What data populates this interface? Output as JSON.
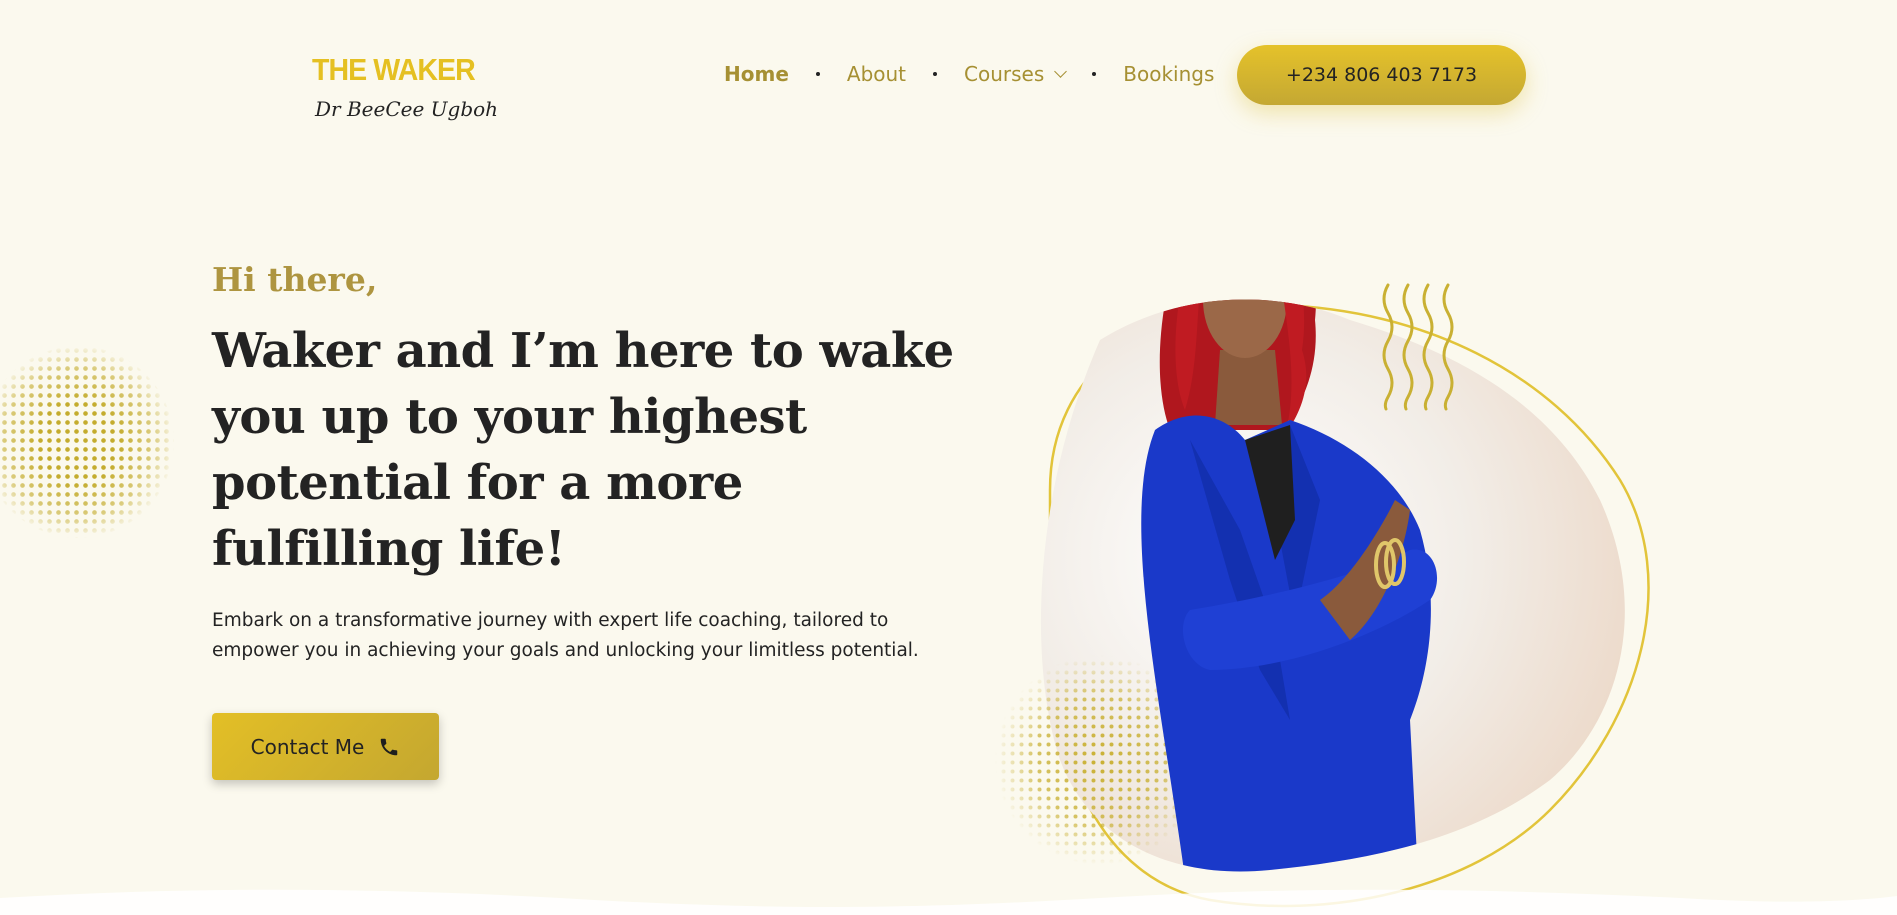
{
  "header": {
    "logo_title": "THE WAKER",
    "logo_subtitle": "Dr BeeCee Ugboh",
    "nav": [
      {
        "label": "Home",
        "active": true
      },
      {
        "label": "About",
        "active": false
      },
      {
        "label": "Courses",
        "active": false,
        "has_dropdown": true
      },
      {
        "label": "Bookings",
        "active": false
      }
    ],
    "phone": "+234 806 403 7173"
  },
  "hero": {
    "greeting": "Hi there,",
    "headline": "Waker and I’m here to wake you up to your highest potential for a more fulfilling life!",
    "description": "Embark on a transformative journey with expert life coaching, tailored to empower you in achieving your goals and unlocking your limitless potential.",
    "cta_label": "Contact Me",
    "cta_icon": "phone-icon",
    "image_icon": "portrait-photo"
  },
  "colors": {
    "background": "#fbf9ee",
    "accent": "#e5c022",
    "accent_dark": "#a69033",
    "text": "#232323",
    "suit_blue": "#1a39c9",
    "hair_red": "#b0171e"
  }
}
